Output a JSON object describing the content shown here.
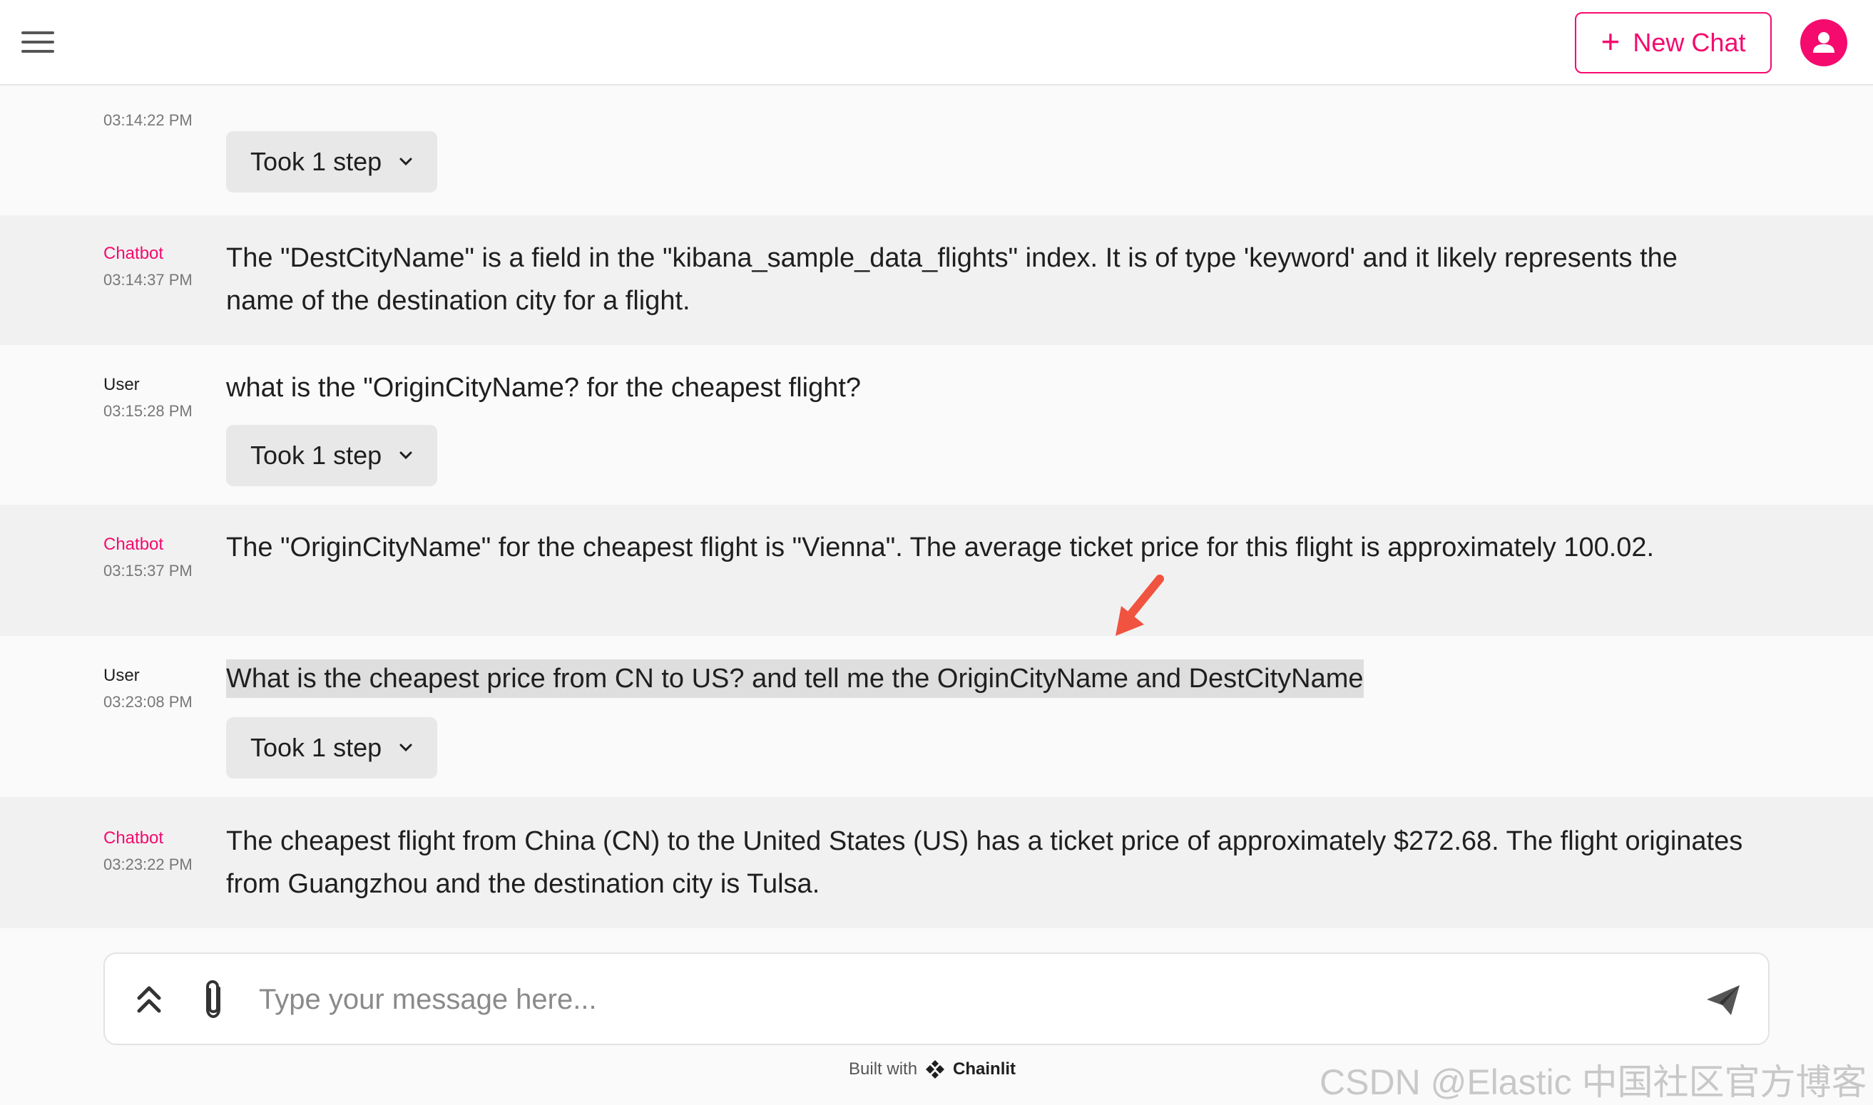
{
  "header": {
    "new_chat_label": "New Chat"
  },
  "messages": [
    {
      "author": "",
      "time": "03:14:22 PM",
      "step_label": "Took 1 step"
    },
    {
      "author": "Chatbot",
      "time": "03:14:37 PM",
      "text": "The \"DestCityName\" is a field in the \"kibana_sample_data_flights\" index. It is of type 'keyword' and it likely represents the name of the destination city for a flight."
    },
    {
      "author": "User",
      "time": "03:15:28 PM",
      "text": "what is the \"OriginCityName? for the cheapest flight?",
      "step_label": "Took 1 step"
    },
    {
      "author": "Chatbot",
      "time": "03:15:37 PM",
      "text": "The \"OriginCityName\" for the cheapest flight is \"Vienna\". The average ticket price for this flight is approximately 100.02."
    },
    {
      "author": "User",
      "time": "03:23:08 PM",
      "text": "What is the cheapest price from CN to US?  and tell me the OriginCityName and DestCityName",
      "step_label": "Took 1 step"
    },
    {
      "author": "Chatbot",
      "time": "03:23:22 PM",
      "text": "The cheapest flight from China (CN) to the United States (US) has a ticket price of approximately $272.68. The flight originates from Guangzhou and the destination city is Tulsa."
    }
  ],
  "composer": {
    "placeholder": "Type your message here..."
  },
  "footer": {
    "built_with": "Built with",
    "brand": "Chainlit"
  },
  "watermark": "CSDN @Elastic 中国社区官方博客",
  "colors": {
    "accent": "#f50a6e",
    "bot_bg": "#f1f1f1",
    "user_bg": "#fafafa",
    "annotation_arrow": "#f0533f"
  },
  "icons": [
    "hamburger-icon",
    "plus-icon",
    "user-avatar-icon",
    "chevron-down-icon",
    "chevrons-up-icon",
    "paperclip-icon",
    "send-icon",
    "chainlit-logo-icon",
    "annotation-arrow"
  ]
}
